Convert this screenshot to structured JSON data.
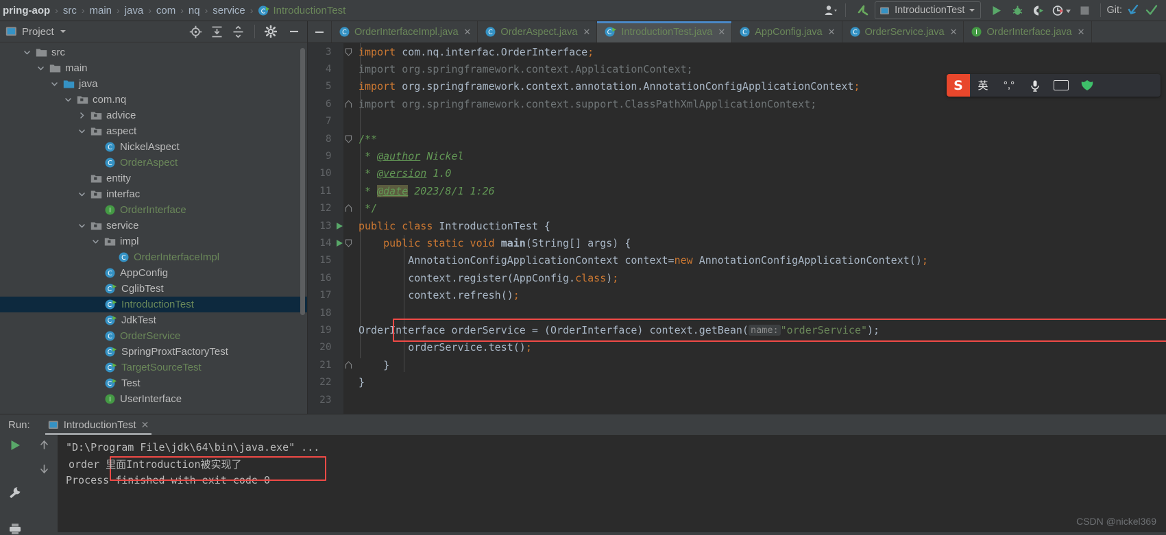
{
  "breadcrumb": {
    "items": [
      {
        "label": "pring-aop",
        "style": "bold"
      },
      {
        "label": "src",
        "style": "normal"
      },
      {
        "label": "main",
        "style": "normal"
      },
      {
        "label": "java",
        "style": "normal"
      },
      {
        "label": "com",
        "style": "normal"
      },
      {
        "label": "nq",
        "style": "normal"
      },
      {
        "label": "service",
        "style": "normal"
      },
      {
        "label": "IntroductionTest",
        "style": "green"
      }
    ],
    "separator": "›"
  },
  "toolbar": {
    "user_icon": "user-avatar-icon",
    "back_icon": "back-arrow-icon",
    "run_config_name": "IntroductionTest",
    "run_icon": "run-play-icon",
    "debug_icon": "debug-bug-icon",
    "run_coverage_icon": "run-with-coverage-icon",
    "profiler_icon": "profiler-icon",
    "stop_icon": "stop-square-icon",
    "git_label": "Git:",
    "git_update_icon": "git-update-arrow-icon",
    "git_commit_icon": "git-commit-check-icon"
  },
  "sidebar": {
    "title": "Project",
    "head_icons": [
      "locate-target-icon",
      "expand-all-icon",
      "collapse-all-icon",
      "gear-icon",
      "hide-minus-icon"
    ],
    "tree": [
      {
        "label": "src",
        "indent": 1,
        "twisty": "down",
        "icon": "folder",
        "color": "normal"
      },
      {
        "label": "main",
        "indent": 2,
        "twisty": "down",
        "icon": "folder",
        "color": "normal"
      },
      {
        "label": "java",
        "indent": 3,
        "twisty": "down",
        "icon": "folder-blue",
        "color": "normal"
      },
      {
        "label": "com.nq",
        "indent": 4,
        "twisty": "down",
        "icon": "package",
        "color": "normal"
      },
      {
        "label": "advice",
        "indent": 5,
        "twisty": "right",
        "icon": "package",
        "color": "normal"
      },
      {
        "label": "aspect",
        "indent": 5,
        "twisty": "down",
        "icon": "package",
        "color": "normal"
      },
      {
        "label": "NickelAspect",
        "indent": 6,
        "twisty": "none",
        "icon": "class",
        "color": "normal"
      },
      {
        "label": "OrderAspect",
        "indent": 6,
        "twisty": "none",
        "icon": "class",
        "color": "green"
      },
      {
        "label": "entity",
        "indent": 5,
        "twisty": "none",
        "icon": "package",
        "color": "normal"
      },
      {
        "label": "interfac",
        "indent": 5,
        "twisty": "down",
        "icon": "package",
        "color": "normal"
      },
      {
        "label": "OrderInterface",
        "indent": 6,
        "twisty": "none",
        "icon": "interface",
        "color": "green"
      },
      {
        "label": "service",
        "indent": 5,
        "twisty": "down",
        "icon": "package",
        "color": "normal"
      },
      {
        "label": "impl",
        "indent": 6,
        "twisty": "down",
        "icon": "package",
        "color": "normal"
      },
      {
        "label": "OrderInterfaceImpl",
        "indent": 7,
        "twisty": "none",
        "icon": "class",
        "color": "green"
      },
      {
        "label": "AppConfig",
        "indent": 6,
        "twisty": "none",
        "icon": "class",
        "color": "normal"
      },
      {
        "label": "CglibTest",
        "indent": 6,
        "twisty": "none",
        "icon": "runnable",
        "color": "normal"
      },
      {
        "label": "IntroductionTest",
        "indent": 6,
        "twisty": "none",
        "icon": "runnable",
        "color": "green",
        "selected": true
      },
      {
        "label": "JdkTest",
        "indent": 6,
        "twisty": "none",
        "icon": "runnable",
        "color": "normal"
      },
      {
        "label": "OrderService",
        "indent": 6,
        "twisty": "none",
        "icon": "class",
        "color": "green"
      },
      {
        "label": "SpringProxtFactoryTest",
        "indent": 6,
        "twisty": "none",
        "icon": "runnable",
        "color": "normal"
      },
      {
        "label": "TargetSourceTest",
        "indent": 6,
        "twisty": "none",
        "icon": "runnable",
        "color": "green"
      },
      {
        "label": "Test",
        "indent": 6,
        "twisty": "none",
        "icon": "runnable",
        "color": "normal"
      },
      {
        "label": "UserInterface",
        "indent": 6,
        "twisty": "none",
        "icon": "interface",
        "color": "normal"
      }
    ]
  },
  "editor": {
    "tabs": [
      {
        "label": "OrderInterfaceImpl.java",
        "icon": "class",
        "active": false
      },
      {
        "label": "OrderAspect.java",
        "icon": "class",
        "active": false
      },
      {
        "label": "IntroductionTest.java",
        "icon": "runnable",
        "active": true
      },
      {
        "label": "AppConfig.java",
        "icon": "class",
        "active": false
      },
      {
        "label": "OrderService.java",
        "icon": "class",
        "active": false
      },
      {
        "label": "OrderInterface.java",
        "icon": "interface",
        "active": false
      }
    ],
    "lines": [
      {
        "n": "3",
        "marker": "",
        "fold": "top"
      },
      {
        "n": "4",
        "marker": "",
        "fold": ""
      },
      {
        "n": "5",
        "marker": "",
        "fold": ""
      },
      {
        "n": "6",
        "marker": "",
        "fold": "bottom"
      },
      {
        "n": "7",
        "marker": "",
        "fold": ""
      },
      {
        "n": "8",
        "marker": "",
        "fold": "top"
      },
      {
        "n": "9",
        "marker": "",
        "fold": ""
      },
      {
        "n": "10",
        "marker": "",
        "fold": ""
      },
      {
        "n": "11",
        "marker": "",
        "fold": ""
      },
      {
        "n": "12",
        "marker": "",
        "fold": "bottom"
      },
      {
        "n": "13",
        "marker": "run",
        "fold": ""
      },
      {
        "n": "14",
        "marker": "run",
        "fold": "top"
      },
      {
        "n": "15",
        "marker": "",
        "fold": ""
      },
      {
        "n": "16",
        "marker": "",
        "fold": ""
      },
      {
        "n": "17",
        "marker": "",
        "fold": ""
      },
      {
        "n": "18",
        "marker": "",
        "fold": ""
      },
      {
        "n": "19",
        "marker": "",
        "fold": ""
      },
      {
        "n": "20",
        "marker": "",
        "fold": ""
      },
      {
        "n": "21",
        "marker": "",
        "fold": "bottom"
      },
      {
        "n": "22",
        "marker": "",
        "fold": ""
      },
      {
        "n": "23",
        "marker": "",
        "fold": ""
      }
    ],
    "code": {
      "l3": "import com.nq.interfac.OrderInterface;",
      "l4": "import org.springframework.context.ApplicationContext;",
      "l5": "import org.springframework.context.annotation.AnnotationConfigApplicationContext;",
      "l6": "import org.springframework.context.support.ClassPathXmlApplicationContext;",
      "l8": "/**",
      "l9_star": "* ",
      "l9_tag": "@author",
      "l9_val": " Nickel",
      "l10_tag": "@version",
      "l10_val": " 1.0",
      "l11_tag": "@date",
      "l11_val": " 2023/8/1 1:26",
      "l12": "*/",
      "l13": "public class IntroductionTest {",
      "l14": "public static void main(String[] args) {",
      "l15": "AnnotationConfigApplicationContext context=new AnnotationConfigApplicationContext();",
      "l16": "context.register(AppConfig.class);",
      "l17": "context.refresh();",
      "l19_a": "OrderInterface orderService = (OrderInterface) context.getBean(",
      "l19_hint": "name:",
      "l19_b": "\"orderService\"",
      "l19_c": ");",
      "l20": "orderService.test();",
      "l21": "}",
      "l22": "}"
    }
  },
  "run_panel": {
    "label": "Run:",
    "tab_name": "IntroductionTest",
    "side_icons": [
      "rerun-play-icon",
      "up-arrow-icon",
      "down-arrow-icon",
      "wrench-icon",
      "print-icon"
    ],
    "console": [
      "\"D:\\Program File\\jdk\\64\\bin\\java.exe\" ...",
      "order 里面Introduction被实现了",
      "Process finished with exit code 0"
    ],
    "highlight_line_index": 1
  },
  "ime_bar": {
    "logo": "S",
    "mode_label": "英",
    "punct_label": "°,°",
    "mic_icon": "microphone-icon",
    "keyboard_icon": "keyboard-icon",
    "fan_icon": "toolbox-fan-icon"
  },
  "watermark": "CSDN @nickel369",
  "colors": {
    "accent_blue": "#4a88c7",
    "selection_blue": "#0d293e",
    "highlight_red": "#f04a46",
    "green_text": "#6a8759",
    "keyword_orange": "#cc7832",
    "editor_bg": "#2b2b2b",
    "chrome_bg": "#3c3f41"
  }
}
